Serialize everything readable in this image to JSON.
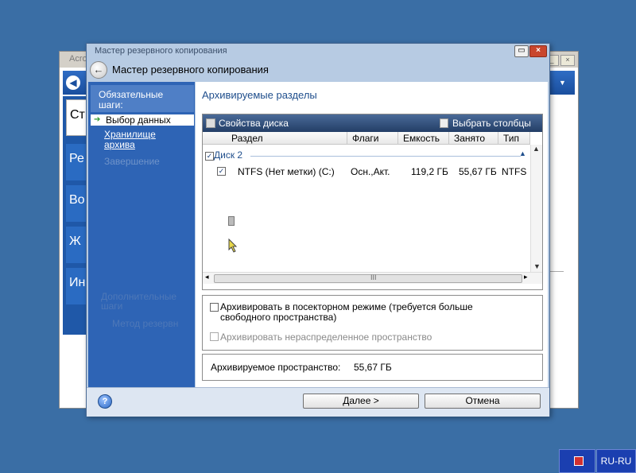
{
  "background_window": {
    "title": "Acro",
    "tiles": [
      "Ст",
      "Ре",
      "Во",
      "Ж",
      "Ин"
    ]
  },
  "wizard": {
    "window_title": "Мастер резервного копирования",
    "header_title": "Мастер резервного копирования",
    "colors": {
      "nav_bg": "#2e64b5",
      "header_accent": "#1f4e8c",
      "toolbar_bg": "#233e66"
    }
  },
  "nav": {
    "required_steps": "Обязательные шаги:",
    "current_step": "Выбор данных",
    "storage_step": "Хранилище архива",
    "finish_step": "Завершение",
    "optional_steps": "Дополнительные шаги",
    "method_step": "Метод резервн"
  },
  "main": {
    "title": "Архивируемые разделы",
    "toolbar": {
      "disk_props": "Свойства диска",
      "choose_columns": "Выбрать столбцы"
    },
    "columns": [
      "Раздел",
      "Флаги",
      "Емкость",
      "Занято",
      "Тип"
    ],
    "disk_group": "Диск 2",
    "rows": [
      {
        "partition": "NTFS (Нет метки) (C:)",
        "flags": "Осн.,Акт.",
        "capacity": "119,2 ГБ",
        "used": "55,67 ГБ",
        "type": "NTFS",
        "checked": true
      }
    ],
    "scroll_grip": "III",
    "options": {
      "sector_mode": "Архивировать в посекторном режиме (требуется больше свободного пространства)",
      "unallocated": "Архивировать нераспределенное пространство"
    },
    "space_label": "Архивируемое пространство:",
    "space_value": "55,67 ГБ"
  },
  "footer": {
    "next": "Далее >",
    "cancel": "Отмена"
  },
  "taskbar": {
    "language": "RU-RU"
  }
}
